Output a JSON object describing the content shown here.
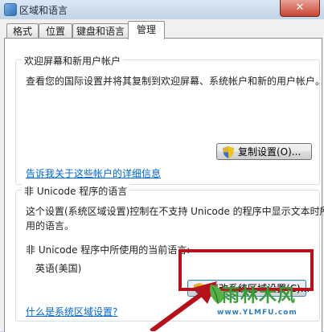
{
  "window": {
    "title": "区域和语言",
    "close_label": "✕"
  },
  "tabs": [
    {
      "label": "格式",
      "active": false
    },
    {
      "label": "位置",
      "active": false
    },
    {
      "label": "键盘和语言",
      "active": false
    },
    {
      "label": "管理",
      "active": true
    }
  ],
  "welcome_group": {
    "title": "欢迎屏幕和新用户帐户",
    "description": "查看您的国际设置并将其复制到欢迎屏幕、系统帐户和新的用户帐户。",
    "copy_button": "复制设置(O)...",
    "link": "告诉我关于这些帐户的详细信息"
  },
  "unicode_group": {
    "title": "非 Unicode 程序的语言",
    "description_line1": "这个设置(系统区域设置)控制在不支持 Unicode 的程序中显示文本时所使",
    "description_line2": "用的语言。",
    "current_label": "非 Unicode 程序中所使用的当前语言:",
    "current_value": "英语(美国)",
    "change_button": "更改系统区域设置(C)...",
    "link": "什么是系统区域设置?"
  },
  "watermark": {
    "title": "雨林木风",
    "url": "www.YLMFU.com"
  },
  "colors": {
    "highlight": "#b5121b",
    "link": "#0066cc",
    "close": "#c7442f"
  }
}
